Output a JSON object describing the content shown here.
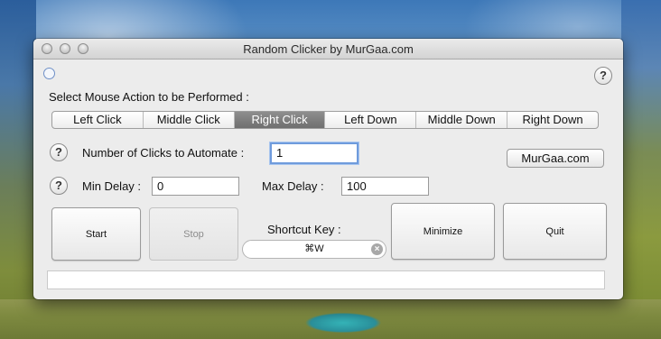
{
  "window": {
    "title": "Random Clicker by MurGaa.com"
  },
  "action_prompt": "Select Mouse Action to be Performed :",
  "actions": {
    "left_click": "Left Click",
    "middle_click": "Middle Click",
    "right_click": "Right Click",
    "left_down": "Left Down",
    "middle_down": "Middle Down",
    "right_down": "Right Down",
    "selected": "Right Click"
  },
  "help_icon": "?",
  "clicks": {
    "label": "Number of Clicks to Automate :",
    "value": "1"
  },
  "murgaa_button": "MurGaa.com",
  "delay": {
    "min_label": "Min Delay :",
    "min_value": "0",
    "max_label": "Max Delay :",
    "max_value": "100"
  },
  "buttons": {
    "start": "Start",
    "stop": "Stop",
    "minimize": "Minimize",
    "quit": "Quit"
  },
  "shortcut": {
    "label": "Shortcut Key :",
    "value": "⌘W"
  },
  "colors": {
    "selected_segment": "#7f7f7f",
    "focus_ring": "#6f9bdc"
  },
  "icons": [
    "close-window-icon",
    "minimize-window-icon",
    "zoom-window-icon",
    "help-icon",
    "clear-icon"
  ]
}
